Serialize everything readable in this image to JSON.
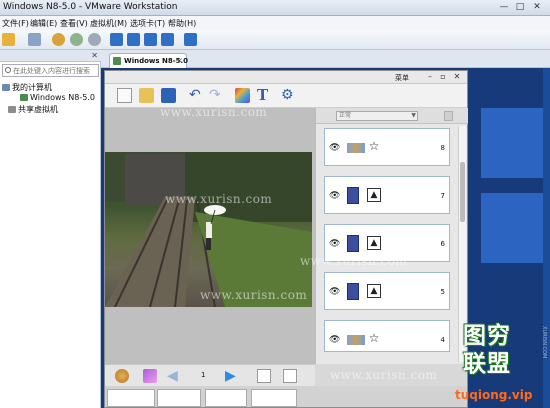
{
  "window": {
    "title": "Windows N8-5.0 - VMware Workstation",
    "controls": [
      "—",
      "□",
      "✕"
    ]
  },
  "menu": [
    "文件(F)",
    "编辑(E)",
    "查看(V)",
    "虚拟机(M)",
    "选项卡(T)",
    "帮助(H)"
  ],
  "library": {
    "search_placeholder": "在此处键入内容进行搜索",
    "my_computer": "我的计算机",
    "vm_name": "Windows N8-5.0",
    "shared": "共享虚拟机"
  },
  "vm_tab": {
    "label": "Windows N8-5.0"
  },
  "app": {
    "menu_label": "菜单",
    "page_number": "1",
    "blend_mode": "正常",
    "layers": [
      {
        "num": "8",
        "thumb": "wide",
        "kind": "star"
      },
      {
        "num": "7",
        "thumb": "tall",
        "kind": "image"
      },
      {
        "num": "6",
        "thumb": "tall",
        "kind": "image"
      },
      {
        "num": "5",
        "thumb": "tall",
        "kind": "image"
      },
      {
        "num": "4",
        "thumb": "wide",
        "kind": "star"
      }
    ]
  },
  "watermarks": [
    "www.xurisn.com",
    "www.xurisn.com",
    "www.xurisn.com",
    "www.xurisn.com",
    "www.xurisn.com"
  ],
  "logo": {
    "line1": "图穷",
    "line2": "联盟",
    "url": "tuqiong.vip",
    "side": "XURISN.COM"
  },
  "colors": {
    "guest_desktop": "#173a7a",
    "accent_blue": "#2d6ac9",
    "logo_green": "#1d7d1d",
    "logo_url": "#ff6a1a"
  }
}
